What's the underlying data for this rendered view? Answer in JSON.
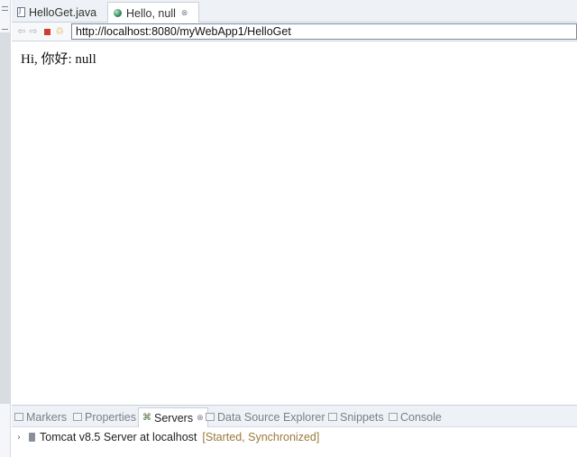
{
  "editor_tabs": [
    {
      "label": "HelloGet.java",
      "icon": "java-file-icon",
      "active": false
    },
    {
      "label": "Hello, null",
      "icon": "globe-icon",
      "active": true,
      "close": "⊗"
    }
  ],
  "browser": {
    "back_glyph": "⇦",
    "forward_glyph": "⇨",
    "refresh_glyph": "♲",
    "url": "http://localhost:8080/myWebApp1/HelloGet"
  },
  "page": {
    "content_text": "Hi, 你好: null"
  },
  "bottom_panel": {
    "tabs": [
      {
        "label": "Markers",
        "icon": "markers-icon",
        "active": false
      },
      {
        "label": "Properties",
        "icon": "properties-icon",
        "active": false
      },
      {
        "label": "Servers",
        "icon": "servers-icon",
        "active": true,
        "close": "⊗"
      },
      {
        "label": "Data Source Explorer",
        "icon": "database-icon",
        "active": false
      },
      {
        "label": "Snippets",
        "icon": "snippets-icon",
        "active": false
      },
      {
        "label": "Console",
        "icon": "console-icon",
        "active": false
      }
    ],
    "servers": [
      {
        "expand_glyph": "›",
        "name": "Tomcat v8.5 Server at localhost",
        "status": "[Started, Synchronized]"
      }
    ]
  },
  "colors": {
    "status_text": "#9a7a3a",
    "stop_red": "#d13d2e",
    "tab_bar_bg": "#eef1f5"
  }
}
